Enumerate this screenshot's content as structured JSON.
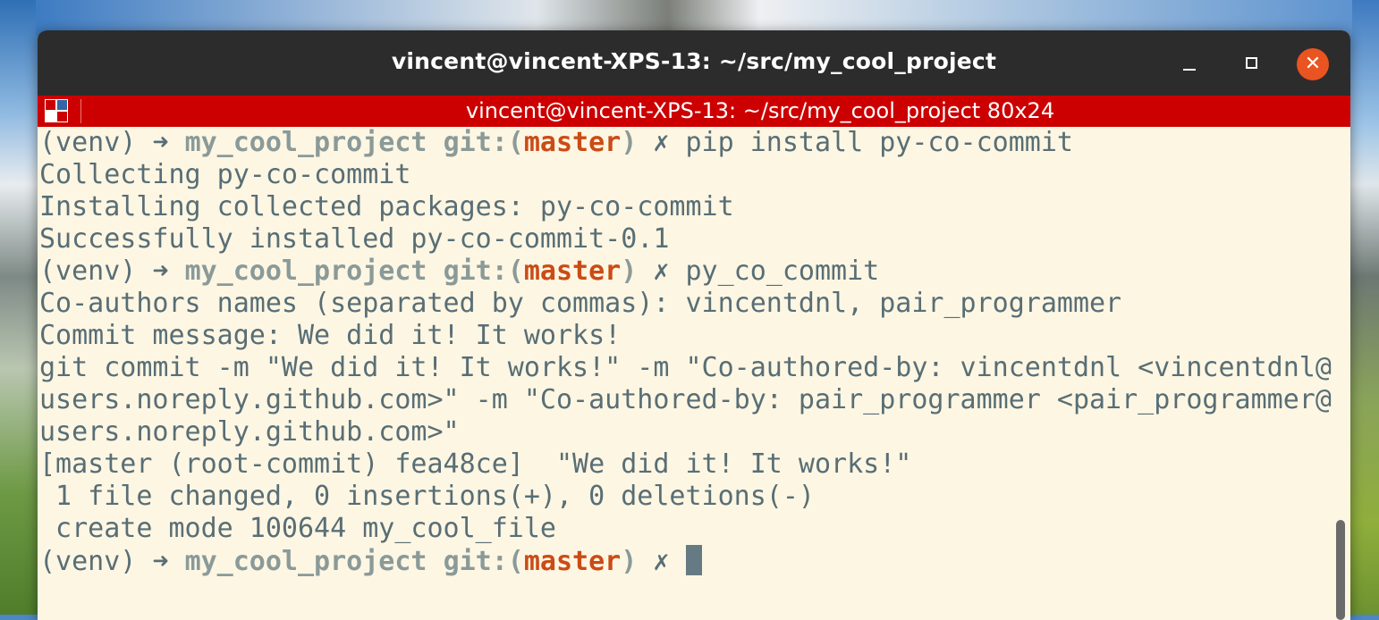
{
  "window": {
    "title": "vincent@vincent-XPS-13: ~/src/my_cool_project",
    "close_glyph": "✕"
  },
  "tab": {
    "title": "vincent@vincent-XPS-13: ~/src/my_cool_project 80x24",
    "icon": "terminator-icon",
    "icon_colors": [
      "#cc0000",
      "#3465a4",
      "#ffffff",
      "#cc0000"
    ]
  },
  "colors": {
    "titlebar": "#2c2c2c",
    "tabbar": "#cc0000",
    "terminal_bg": "#fdf6e3",
    "terminal_fg": "#586e75",
    "branch": "#cb4b16",
    "close_button": "#e95420"
  },
  "prompt": {
    "venv": "(venv)",
    "arrow": "➜",
    "dir": "my_cool_project",
    "git_prefix": "git:(",
    "branch": "master",
    "git_suffix": ")",
    "dirty": "✗"
  },
  "terminal": {
    "cmd1": "pip install py-co-commit",
    "lines": [
      "Collecting py-co-commit",
      "Installing collected packages: py-co-commit",
      "Successfully installed py-co-commit-0.1"
    ],
    "cmd2": "py_co_commit",
    "lines2": [
      "Co-authors names (separated by commas): vincentdnl, pair_programmer",
      "Commit message: We did it! It works!",
      "git commit -m \"We did it! It works!\" -m \"Co-authored-by: vincentdnl <vincentdnl@",
      "users.noreply.github.com>\" -m \"Co-authored-by: pair_programmer <pair_programmer@",
      "users.noreply.github.com>\"",
      "[master (root-commit) fea48ce]  \"We did it! It works!\"",
      " 1 file changed, 0 insertions(+), 0 deletions(-)",
      " create mode 100644 my_cool_file"
    ]
  }
}
